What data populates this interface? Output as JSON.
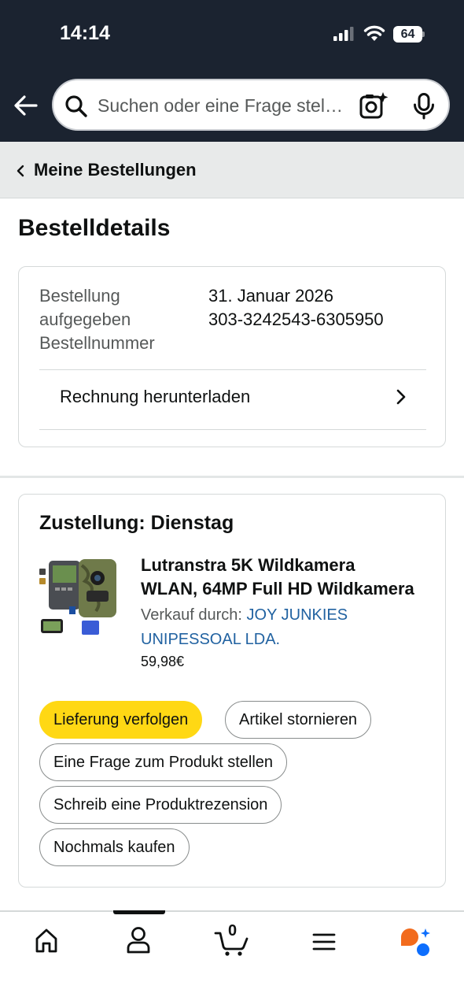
{
  "status_bar": {
    "time": "14:14",
    "battery": "64"
  },
  "search": {
    "placeholder": "Suchen oder eine Frage stellen"
  },
  "breadcrumb": {
    "label": "Meine Bestellungen"
  },
  "page": {
    "title": "Bestelldetails"
  },
  "order": {
    "placed_label": "Bestellung aufgegeben",
    "placed_value": "31. Januar 2026",
    "number_label": "Bestellnummer",
    "number_value": "303-3242543-6305950",
    "invoice_label": "Rechnung herunterladen"
  },
  "delivery": {
    "title": "Zustellung: Dienstag",
    "product": {
      "title_line1": "Lutranstra 5K Wildkamera",
      "title_line2": "WLAN, 64MP Full HD Wildkamera",
      "seller_prefix": "Verkauf durch: ",
      "seller_name": "JOY JUNKIES UNIPESSOAL LDA.",
      "price": "59,98€"
    },
    "buttons": {
      "track": "Lieferung verfolgen",
      "cancel": "Artikel stornieren",
      "ask": "Eine Frage zum Produkt stellen",
      "review": "Schreib eine Produktrezension",
      "buy_again": "Nochmals kaufen"
    }
  },
  "bottom_nav": {
    "cart_count": "0",
    "active_tab": "account"
  },
  "colors": {
    "header_bg": "#1b2330",
    "primary_button": "#ffd814",
    "link": "#2162a1"
  }
}
